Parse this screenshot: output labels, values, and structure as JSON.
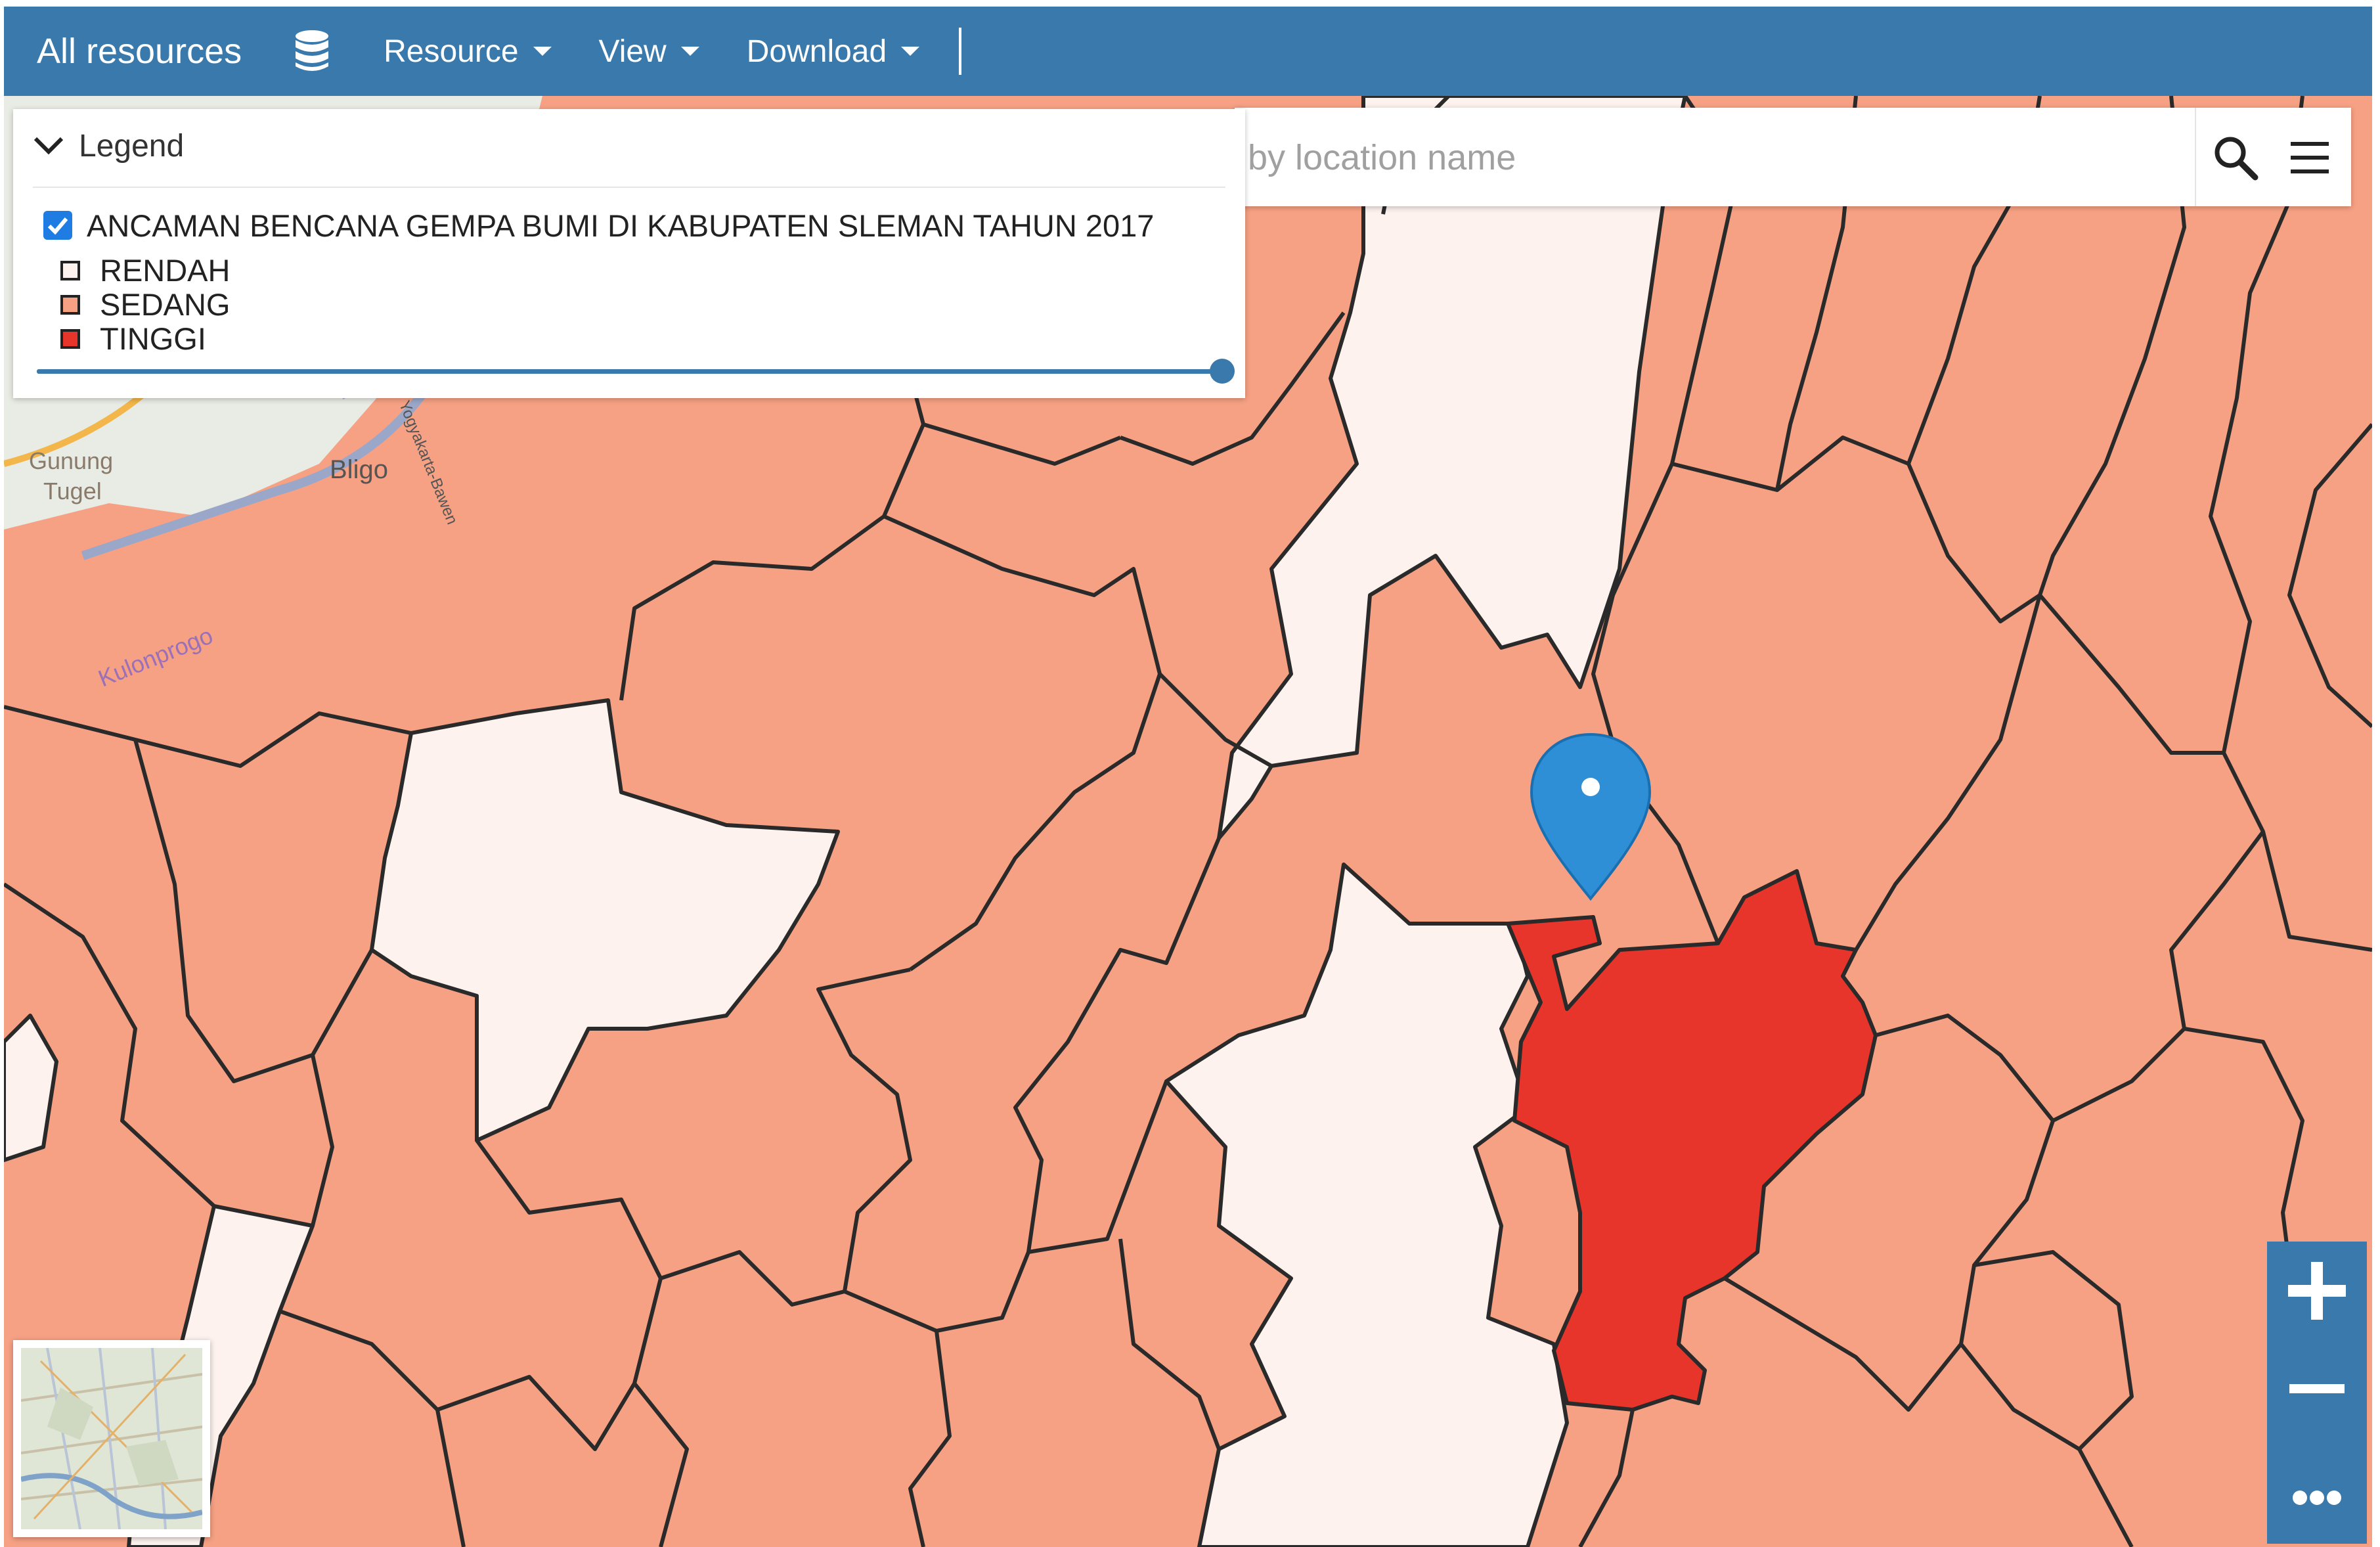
{
  "toolbar": {
    "title": "All resources",
    "menus": [
      "Resource",
      "View",
      "Download"
    ]
  },
  "search": {
    "placeholder": "by location name"
  },
  "legend": {
    "header": "Legend",
    "layer_title": "ANCAMAN BENCANA GEMPA BUMI DI KABUPATEN SLEMAN TAHUN 2017",
    "layer_visible": true,
    "opacity": 1.0,
    "items": [
      {
        "label": "RENDAH",
        "color": "#fdf2ee"
      },
      {
        "label": "SEDANG",
        "color": "#f7a184"
      },
      {
        "label": "TINGGI",
        "color": "#e8352b"
      }
    ]
  },
  "basemap_labels": {
    "place1": "Gunung",
    "place1b": "Tugel",
    "place2": "Bligo",
    "place3": "Kulonprogo",
    "road": "Jl. Yogyakarta-Bawen"
  },
  "colors": {
    "toolbar": "#3a79ab",
    "rendah": "#fdf2ee",
    "sedang": "#f7a184",
    "tinggi": "#e8352b",
    "marker": "#2f8fd6"
  },
  "icons": [
    "database-icon",
    "search-icon",
    "menu-icon",
    "chevron-down-icon",
    "map-marker-icon",
    "zoom-in-icon",
    "zoom-out-icon",
    "more-icon"
  ]
}
